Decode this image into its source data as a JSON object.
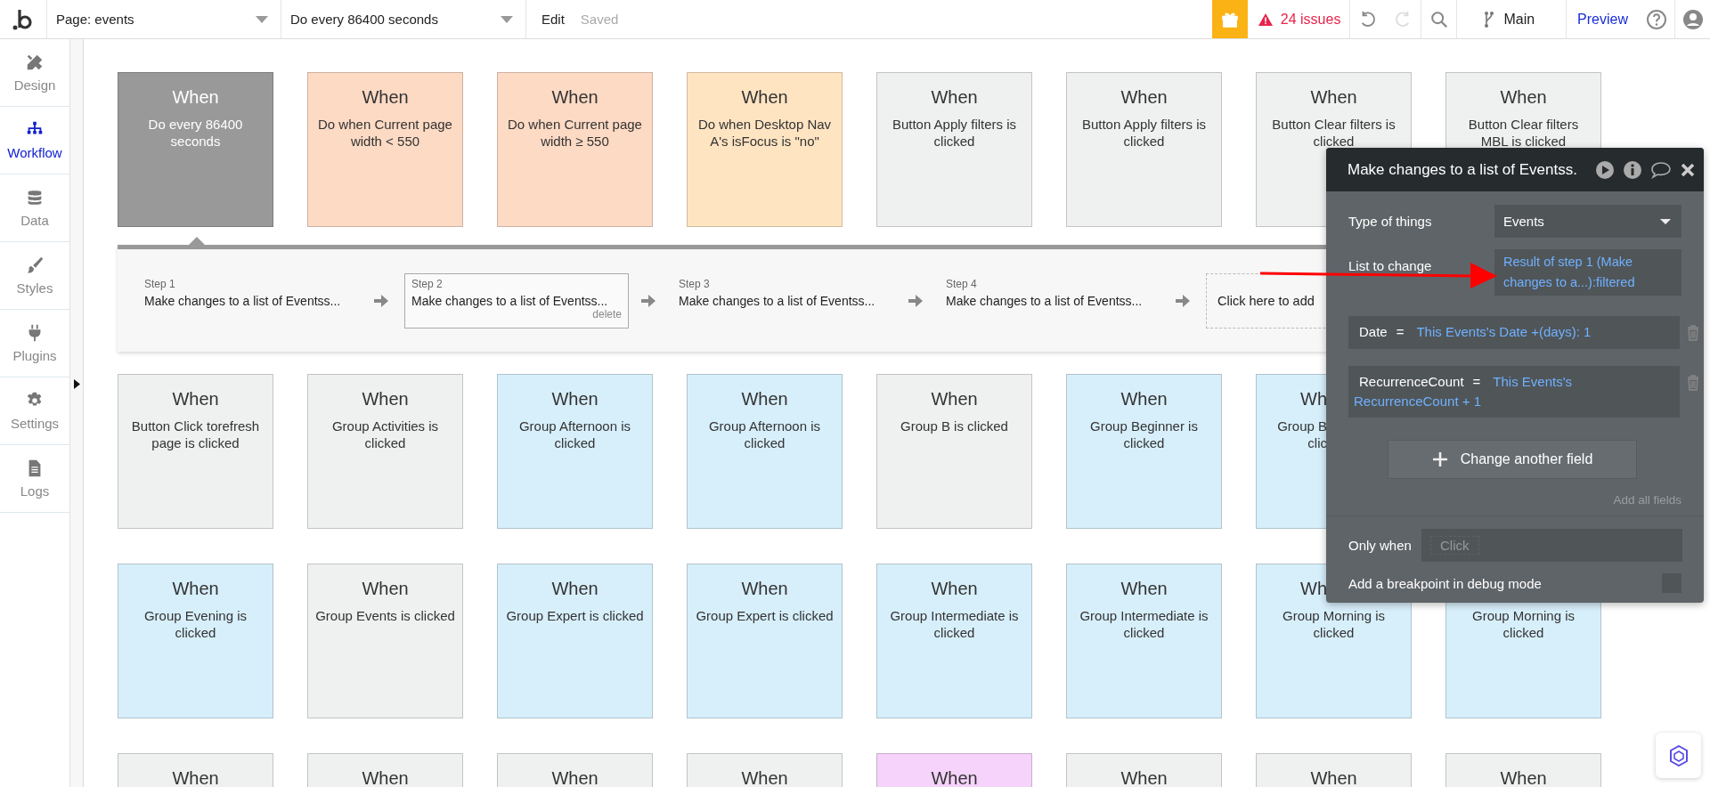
{
  "topbar": {
    "page_dropdown": "Page: events",
    "event_dropdown": "Do every 86400 seconds",
    "edit": "Edit",
    "status": "Saved",
    "issues": "24 issues",
    "undo": {
      "disabled": false
    },
    "redo": {
      "disabled": true
    },
    "branch": "Main",
    "preview": "Preview"
  },
  "sidebar": {
    "items": [
      {
        "label": "Design",
        "selected": false
      },
      {
        "label": "Workflow",
        "selected": true
      },
      {
        "label": "Data",
        "selected": false
      },
      {
        "label": "Styles",
        "selected": false
      },
      {
        "label": "Plugins",
        "selected": false
      },
      {
        "label": "Settings",
        "selected": false
      },
      {
        "label": "Logs",
        "selected": false
      }
    ]
  },
  "events_rows": [
    [
      {
        "kind": "plain",
        "title": "When",
        "lines": [
          "Do every 86400",
          "seconds"
        ],
        "color": "#999999",
        "selected": true
      },
      {
        "kind": "plain",
        "title": "When",
        "lines": [
          "Do when Current page",
          "width < 550"
        ],
        "color": "#fddac4",
        "selected": false
      },
      {
        "kind": "plain",
        "title": "When",
        "lines": [
          "Do when Current page",
          "width ≥ 550"
        ],
        "color": "#fddac4",
        "selected": false
      },
      {
        "kind": "plain",
        "title": "When",
        "lines": [
          "Do when Desktop Nav",
          "A's isFocus is \"no\""
        ],
        "color": "#ffe4c2",
        "selected": false
      },
      {
        "kind": "plain",
        "title": "When",
        "lines": [
          "Button Apply filters is",
          "clicked"
        ],
        "color": "#eff0f0",
        "selected": false
      },
      {
        "kind": "plain",
        "title": "When",
        "lines": [
          "Button Apply filters is",
          "clicked"
        ],
        "color": "#eff0f0",
        "selected": false
      },
      {
        "kind": "plain",
        "title": "When",
        "lines": [
          "Button Clear filters is",
          "clicked"
        ],
        "color": "#eff0f0",
        "selected": false
      },
      {
        "kind": "plain",
        "title": "When",
        "lines": [
          "Button Clear filters",
          "MBL is clicked"
        ],
        "color": "#eff0f0",
        "selected": false
      }
    ],
    [
      {
        "kind": "plain",
        "title": "When",
        "lines": [
          "Button Click torefresh",
          "page is clicked"
        ],
        "color": "#eff0f0",
        "selected": false
      },
      {
        "kind": "plain",
        "title": "When",
        "lines": [
          "Group Activities is",
          "clicked"
        ],
        "color": "#eff0f0",
        "selected": false
      },
      {
        "kind": "plain",
        "title": "When",
        "lines": [
          "Group Afternoon is",
          "clicked"
        ],
        "color": "#d7effb",
        "selected": false
      },
      {
        "kind": "plain",
        "title": "When",
        "lines": [
          "Group Afternoon is",
          "clicked"
        ],
        "color": "#d7effb",
        "selected": false
      },
      {
        "kind": "plain",
        "title": "When",
        "lines": [
          "Group B is clicked"
        ],
        "color": "#eff0f0",
        "selected": false
      },
      {
        "kind": "plain",
        "title": "When",
        "lines": [
          "Group Beginner is",
          "clicked"
        ],
        "color": "#d7effb",
        "selected": false
      },
      {
        "kind": "covered",
        "title": "Wh",
        "lines": [
          "Group B",
          "clic"
        ],
        "color": "#d7effb",
        "selected": false
      }
    ],
    [
      {
        "kind": "plain",
        "title": "When",
        "lines": [
          "Group Evening is",
          "clicked"
        ],
        "color": "#d7effb",
        "selected": false
      },
      {
        "kind": "plain",
        "title": "When",
        "lines": [
          "Group Events is clicked"
        ],
        "color": "#eff0f0",
        "selected": false
      },
      {
        "kind": "plain",
        "title": "When",
        "lines": [
          "Group Expert is clicked"
        ],
        "color": "#d7effb",
        "selected": false
      },
      {
        "kind": "plain",
        "title": "When",
        "lines": [
          "Group Expert is clicked"
        ],
        "color": "#d7effb",
        "selected": false
      },
      {
        "kind": "plain",
        "title": "When",
        "lines": [
          "Group Intermediate is",
          "clicked"
        ],
        "color": "#d7effb",
        "selected": false
      },
      {
        "kind": "plain",
        "title": "When",
        "lines": [
          "Group Intermediate is",
          "clicked"
        ],
        "color": "#d7effb",
        "selected": false
      },
      {
        "kind": "title-covered",
        "title": "Wh",
        "lines": [
          "Group Morning is",
          "clicked"
        ],
        "color": "#d7effb",
        "selected": false
      },
      {
        "kind": "plain",
        "lines": [
          "Group Morning is",
          "clicked"
        ],
        "color": "#d7effb",
        "selected": false
      }
    ],
    [
      {
        "kind": "plain",
        "title": "When",
        "color": "#eff0f0",
        "selected": false
      },
      {
        "kind": "plain",
        "title": "When",
        "color": "#eff0f0",
        "selected": false
      },
      {
        "kind": "plain",
        "title": "When",
        "color": "#eff0f0",
        "selected": false
      },
      {
        "kind": "plain",
        "title": "When",
        "color": "#eff0f0",
        "selected": false
      },
      {
        "kind": "plain",
        "title": "When",
        "color": "#f6d3fb",
        "selected": false
      },
      {
        "kind": "plain",
        "title": "When",
        "color": "#eff0f0",
        "selected": false
      },
      {
        "kind": "plain",
        "title": "When",
        "color": "#eff0f0",
        "selected": false
      },
      {
        "kind": "plain",
        "title": "When",
        "color": "#eff0f0",
        "selected": false
      }
    ]
  ],
  "steps": {
    "items": [
      {
        "label": "Step 1",
        "action": "Make changes to a list of Eventss...",
        "selected": false
      },
      {
        "label": "Step 2",
        "action": "Make changes to a list of Eventss...",
        "selected": true,
        "delete": "delete"
      },
      {
        "label": "Step 3",
        "action": "Make changes to a list of Eventss...",
        "selected": false
      },
      {
        "label": "Step 4",
        "action": "Make changes to a list of Eventss...",
        "selected": false
      }
    ],
    "add": "Click here to add"
  },
  "panel": {
    "title": "Make changes to a list of Eventss.",
    "type_label": "Type of things",
    "type_value": "Events",
    "list_label": "List to change",
    "list_value": "Result of step 1 (Make changes to a...):filtered",
    "fields": [
      {
        "name": "Date",
        "operator": "=",
        "value": "This Events's Date +(days): 1"
      },
      {
        "name": "RecurrenceCount",
        "operator": "=",
        "value": "This Events's RecurrenceCount + 1"
      }
    ],
    "add_field": "Change another field",
    "add_all": "Add all fields",
    "only_when_label": "Only when",
    "only_when_placeholder": "Click",
    "breakpoint_label": "Add a breakpoint in debug mode",
    "breakpoint_checked": false
  }
}
